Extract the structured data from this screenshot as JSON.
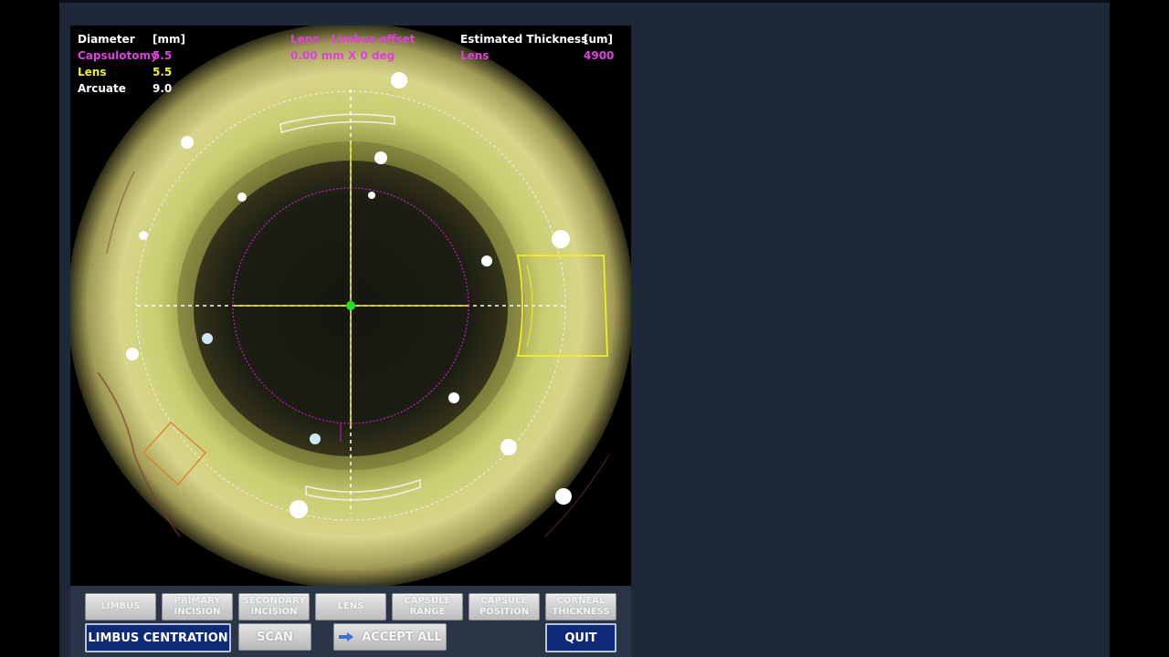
{
  "overlay": {
    "diameter_header": "Diameter",
    "mm_header": "[mm]",
    "rows": [
      {
        "label": "Capsulotomy",
        "value": "5.5",
        "color": "#e040e0"
      },
      {
        "label": "Lens",
        "value": "5.5",
        "color": "#f0f020"
      },
      {
        "label": "Arcuate",
        "value": "9.0",
        "color": "#ffffff"
      }
    ],
    "offset_title": "Lens - Limbus offset",
    "offset_value": "0.00 mm X 0 deg",
    "thickness_header": "Estimated Thickness",
    "um_header": "[um]",
    "thickness_label": "Lens",
    "thickness_value": "4900"
  },
  "steps": [
    {
      "line1": "LIMBUS",
      "line2": ""
    },
    {
      "line1": "PRIMARY",
      "line2": "INCISION"
    },
    {
      "line1": "SECONDARY",
      "line2": "INCISION"
    },
    {
      "line1": "LENS",
      "line2": ""
    },
    {
      "line1": "CAPSULE",
      "line2": "RANGE"
    },
    {
      "line1": "CAPSULE",
      "line2": "POSITION"
    },
    {
      "line1": "CORNEAL",
      "line2": "THICKNESS"
    }
  ],
  "actions": {
    "limbus_centration": "LIMBUS CENTRATION",
    "scan": "SCAN",
    "accept_all": "ACCEPT ALL",
    "quit": "QUIT"
  },
  "colors": {
    "capsulotomy": "#c020c0",
    "lens": "#f0f020",
    "center_dot": "#20e020",
    "incision": "#e07a20"
  },
  "icons": {
    "accept_all": "arrow-right-icon"
  }
}
